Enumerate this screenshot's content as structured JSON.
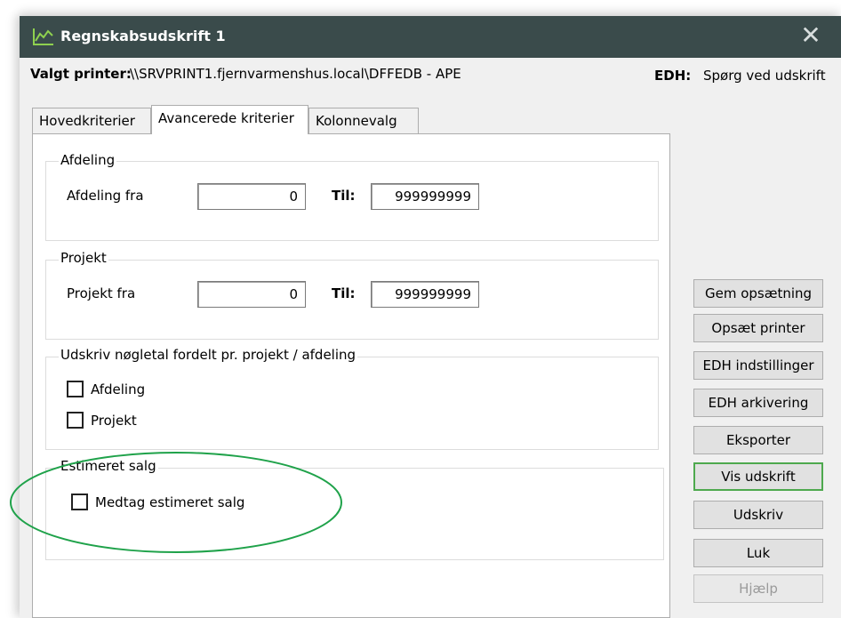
{
  "window": {
    "title": "Regnskabsudskrift 1",
    "close_glyph": "✕"
  },
  "printer": {
    "label": "Valgt printer:",
    "value": "\\\\SRVPRINT1.fjernvarmenshus.local\\DFFEDB - APE"
  },
  "edh": {
    "label": "EDH:",
    "value": "Spørg ved udskrift"
  },
  "tabs": [
    {
      "label": "Hovedkriterier",
      "active": false
    },
    {
      "label": "Avancerede kriterier",
      "active": true
    },
    {
      "label": "Kolonnevalg",
      "active": false
    }
  ],
  "groups": {
    "afdeling": {
      "title": "Afdeling",
      "from_label": "Afdeling fra",
      "from_value": "0",
      "to_label": "Til:",
      "to_value": "999999999"
    },
    "projekt": {
      "title": "Projekt",
      "from_label": "Projekt fra",
      "from_value": "0",
      "to_label": "Til:",
      "to_value": "999999999"
    },
    "noegletal": {
      "title": "Udskriv nøgletal fordelt pr. projekt / afdeling",
      "cb1_label": "Afdeling",
      "cb1_checked": false,
      "cb2_label": "Projekt",
      "cb2_checked": false
    },
    "estimeret": {
      "title": "Estimeret salg",
      "cb_label": "Medtag estimeret salg",
      "cb_checked": false
    }
  },
  "buttons": {
    "gem": "Gem opsætning",
    "opsaet": "Opsæt printer",
    "edh_ind": "EDH indstillinger",
    "edh_ark": "EDH arkivering",
    "eksporter": "Eksporter",
    "vis": "Vis udskrift",
    "udskriv": "Udskriv",
    "luk": "Luk",
    "hjaelp": "Hjælp"
  },
  "colors": {
    "titlebar": "#3a4b4b",
    "annotation": "#1fa24a",
    "default_button_border": "#4ea94e"
  }
}
